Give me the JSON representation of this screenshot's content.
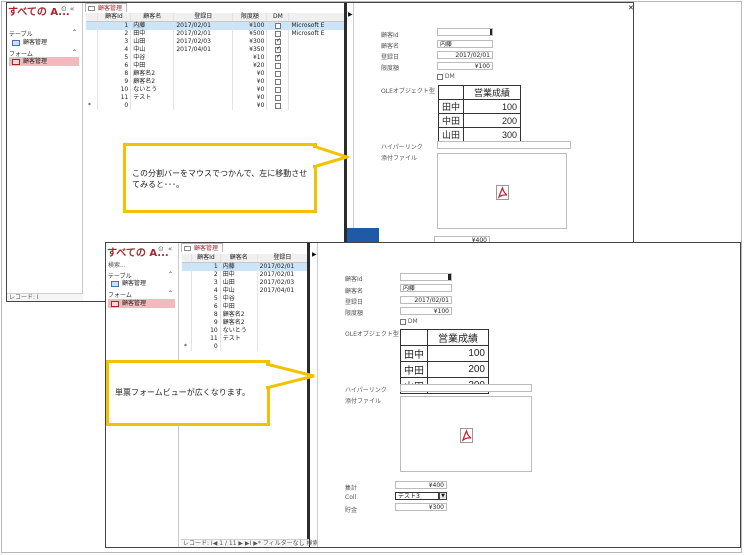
{
  "nav": {
    "title": "すべての A...",
    "search_placeholder": "検索...",
    "section_tables": "テーブル",
    "table_item": "顧客管理",
    "section_forms": "フォーム",
    "form_item": "顧客管理",
    "record_label": "レコード: ",
    "top_record_label": "レコード: I"
  },
  "tab_label": "顧客管理",
  "grid": {
    "columns": [
      "顧客Id",
      "顧客名",
      "登録日",
      "限度額",
      "DM"
    ],
    "rows": [
      {
        "id": "1",
        "name": "内藤",
        "date": "2017/02/01",
        "limit": "¥100",
        "dm": false,
        "extra": "Microsoft E"
      },
      {
        "id": "2",
        "name": "田中",
        "date": "2017/02/01",
        "limit": "¥500",
        "dm": false,
        "extra": "Microsoft E"
      },
      {
        "id": "3",
        "name": "山田",
        "date": "2017/02/03",
        "limit": "¥300",
        "dm": true,
        "extra": ""
      },
      {
        "id": "4",
        "name": "中山",
        "date": "2017/04/01",
        "limit": "¥350",
        "dm": true,
        "extra": ""
      },
      {
        "id": "5",
        "name": "中谷",
        "date": "",
        "limit": "¥10",
        "dm": true,
        "extra": ""
      },
      {
        "id": "6",
        "name": "中田",
        "date": "",
        "limit": "¥20",
        "dm": false,
        "extra": ""
      },
      {
        "id": "8",
        "name": "顧客名2",
        "date": "",
        "limit": "¥0",
        "dm": false,
        "extra": ""
      },
      {
        "id": "9",
        "name": "顧客名2",
        "date": "",
        "limit": "¥0",
        "dm": false,
        "extra": ""
      },
      {
        "id": "10",
        "name": "ないとう",
        "date": "",
        "limit": "¥0",
        "dm": false,
        "extra": ""
      },
      {
        "id": "11",
        "name": "テスト",
        "date": "",
        "limit": "¥0",
        "dm": false,
        "extra": ""
      },
      {
        "id": "0",
        "name": "",
        "date": "",
        "limit": "¥0",
        "dm": false,
        "extra": ""
      }
    ],
    "new_row_marker": "*",
    "bottom_dates": [
      "2017/0",
      "2017/0",
      "2017/0",
      "2017/0"
    ]
  },
  "form": {
    "id_label": "顧客Id",
    "id_value": "1",
    "name_label": "顧客名",
    "name_value": "内藤",
    "date_label": "登録日",
    "date_value": "2017/02/01",
    "limit_label": "限度額",
    "limit_value": "¥100",
    "dm_label": "DM",
    "ole_label": "OLEオブジェクト型",
    "ole_table": {
      "header": "営業成績",
      "rows": [
        [
          "田中",
          "100"
        ],
        [
          "中田",
          "200"
        ],
        [
          "山田",
          "300"
        ]
      ]
    },
    "hyperlink_label": "ハイパーリンク",
    "attachment_label": "添付ファイル",
    "total_top": "¥400",
    "total_label": "集計",
    "total_value": "¥400",
    "coll_label": "Coll",
    "coll_value": "テスト3",
    "savings_label": "貯金",
    "savings_value": "¥300"
  },
  "status_bottom": "レコード: I◀ 1 / 11 ▶ ▶I ▶* フィルターなし 検索",
  "callout_top": "この分割バーをマウスでつかんで、左に移動させてみると･･･。",
  "callout_bottom": "単票フォームビューが広くなります。",
  "icons": [
    "pdf-icon",
    "table-icon",
    "form-icon",
    "down-arrow-icon",
    "close-nav-icon",
    "dropdown-icon"
  ],
  "colors": {
    "accent_red": "#a4262c",
    "callout_yellow": "#f2c200",
    "arrow_blue": "#1f5aa6",
    "selection_blue": "#cce4f7"
  }
}
